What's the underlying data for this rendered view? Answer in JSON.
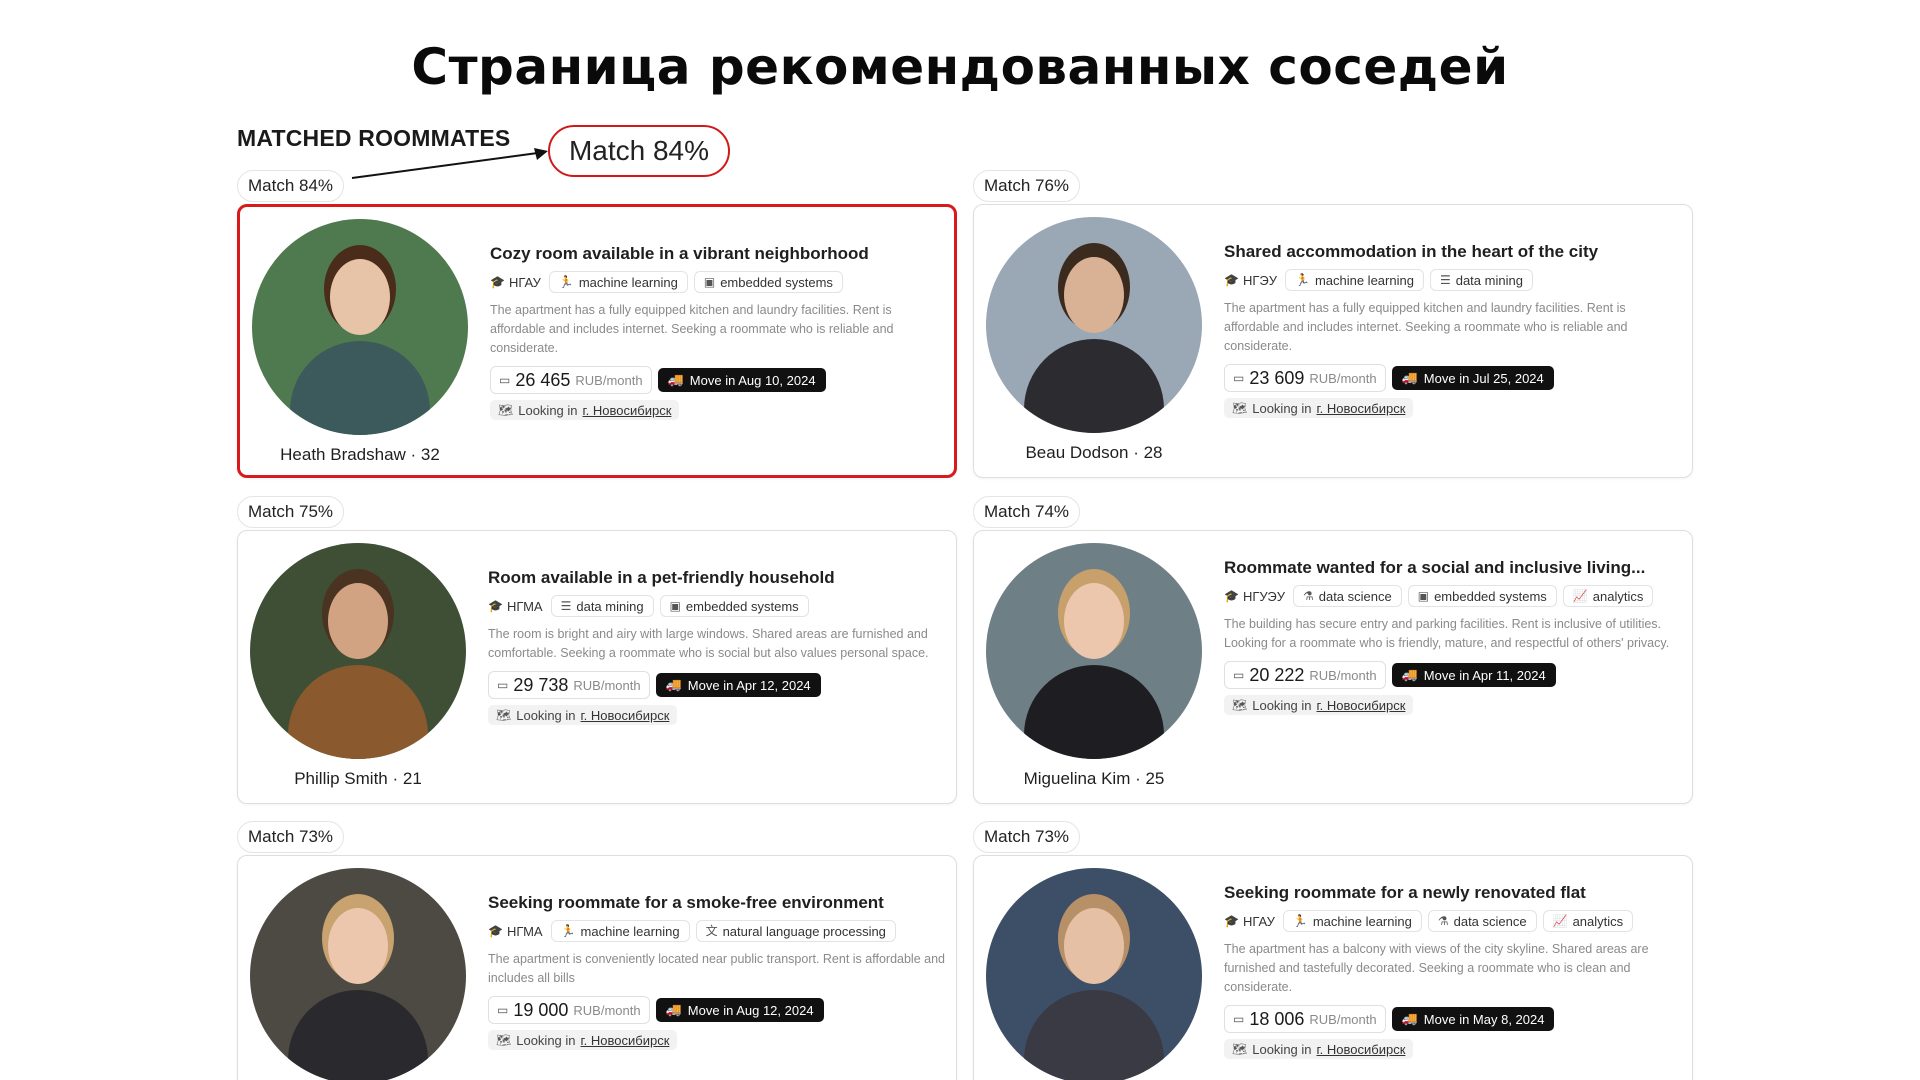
{
  "slide_title": "Страница рекомендованных соседей",
  "section_title": "MATCHED ROOMMATES",
  "callout": "Match 84%",
  "location_prefix": "Looking in",
  "cards": [
    {
      "match": "Match 84%",
      "name": "Heath Bradshaw · 32",
      "title": "Cozy room available in a vibrant neighborhood",
      "university": "НГАУ",
      "tags": [
        {
          "icon": "🏃",
          "label": "machine learning"
        },
        {
          "icon": "▣",
          "label": "embedded systems"
        }
      ],
      "description": "The apartment has a fully equipped kitchen and laundry facilities. Rent is affordable and includes internet. Seeking a roommate who is reliable and considerate.",
      "price": "26 465",
      "price_unit": "RUB/month",
      "move_in": "Move in Aug 10, 2024",
      "location": "г. Новосибирск",
      "highlighted": true
    },
    {
      "match": "Match 76%",
      "name": "Beau Dodson · 28",
      "title": "Shared accommodation in the heart of the city",
      "university": "НГЭУ",
      "tags": [
        {
          "icon": "🏃",
          "label": "machine learning"
        },
        {
          "icon": "☰",
          "label": "data mining"
        }
      ],
      "description": "The apartment has a fully equipped kitchen and laundry facilities. Rent is affordable and includes internet. Seeking a roommate who is reliable and considerate.",
      "price": "23 609",
      "price_unit": "RUB/month",
      "move_in": "Move in Jul 25, 2024",
      "location": "г. Новосибирск",
      "highlighted": false
    },
    {
      "match": "Match 75%",
      "name": "Phillip Smith · 21",
      "title": "Room available in a pet-friendly household",
      "university": "НГМА",
      "tags": [
        {
          "icon": "☰",
          "label": "data mining"
        },
        {
          "icon": "▣",
          "label": "embedded systems"
        }
      ],
      "description": "The room is bright and airy with large windows. Shared areas are furnished and comfortable. Seeking a roommate who is social but also values personal space.",
      "price": "29 738",
      "price_unit": "RUB/month",
      "move_in": "Move in Apr 12, 2024",
      "location": "г. Новосибирск",
      "highlighted": false
    },
    {
      "match": "Match 74%",
      "name": "Miguelina Kim · 25",
      "title": "Roommate wanted for a social and inclusive living...",
      "university": "НГУЭУ",
      "tags": [
        {
          "icon": "⚗",
          "label": "data science"
        },
        {
          "icon": "▣",
          "label": "embedded systems"
        },
        {
          "icon": "📈",
          "label": "analytics"
        }
      ],
      "description": "The building has secure entry and parking facilities. Rent is inclusive of utilities. Looking for a roommate who is friendly, mature, and respectful of others' privacy.",
      "price": "20 222",
      "price_unit": "RUB/month",
      "move_in": "Move in Apr 11, 2024",
      "location": "г. Новосибирск",
      "highlighted": false
    },
    {
      "match": "Match 73%",
      "name": "",
      "title": "Seeking roommate for a smoke-free environment",
      "university": "НГМА",
      "tags": [
        {
          "icon": "🏃",
          "label": "machine learning"
        },
        {
          "icon": "文",
          "label": "natural language processing"
        }
      ],
      "description": "The apartment is conveniently located near public transport. Rent is affordable and includes all bills",
      "price": "19 000",
      "price_unit": "RUB/month",
      "move_in": "Move in Aug 12, 2024",
      "location": "г. Новосибирск",
      "highlighted": false
    },
    {
      "match": "Match 73%",
      "name": "",
      "title": "Seeking roommate for a newly renovated flat",
      "university": "НГАУ",
      "tags": [
        {
          "icon": "🏃",
          "label": "machine learning"
        },
        {
          "icon": "⚗",
          "label": "data science"
        },
        {
          "icon": "📈",
          "label": "analytics"
        }
      ],
      "description": "The apartment has a balcony with views of the city skyline. Shared areas are furnished and tastefully decorated. Seeking a roommate who is clean and considerate.",
      "price": "18 006",
      "price_unit": "RUB/month",
      "move_in": "Move in May 8, 2024",
      "location": "г. Новосибирск",
      "highlighted": false
    }
  ]
}
